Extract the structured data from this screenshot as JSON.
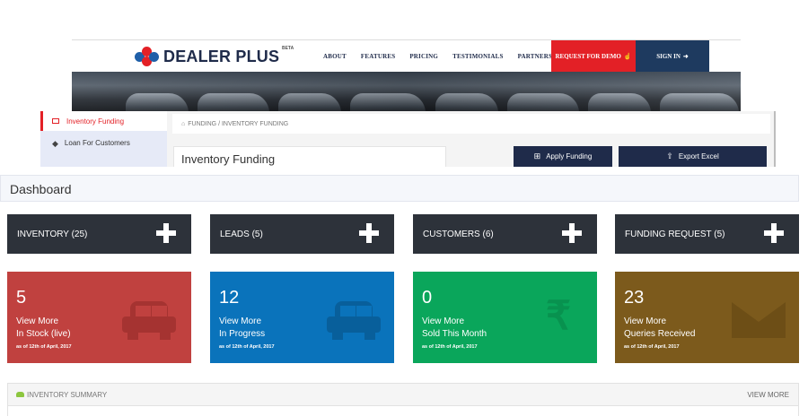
{
  "site": {
    "logo_text": "DEALER PLUS",
    "logo_beta": "BETA",
    "nav": [
      "ABOUT",
      "FEATURES",
      "PRICING",
      "TESTIMONIALS",
      "PARTNERS"
    ],
    "demo_label": "REQUEST FOR DEMO",
    "signin_label": "SIGN IN"
  },
  "sidebar": {
    "active_item": "Inventory Funding",
    "item": "Loan For Customers"
  },
  "inner": {
    "breadcrumb": "FUNDING / INVENTORY FUNDING",
    "title": "Inventory Funding",
    "apply_button": "Apply Funding",
    "export_button": "Export Excel"
  },
  "dashboard": {
    "title": "Dashboard",
    "tiles": [
      {
        "label": "INVENTORY (25)"
      },
      {
        "label": "LEADS (5)"
      },
      {
        "label": "CUSTOMERS (6)"
      },
      {
        "label": "FUNDING REQUEST (5)"
      }
    ],
    "stats": [
      {
        "value": "5",
        "view_more": "View More",
        "subtitle": "In Stock (live)",
        "asof": "as of 12th of April, 2017",
        "color": "#c0413f",
        "icon": "car-icon"
      },
      {
        "value": "12",
        "view_more": "View More",
        "subtitle": "In Progress",
        "asof": "as of 12th of April, 2017",
        "color": "#0a73bb",
        "icon": "car-icon"
      },
      {
        "value": "0",
        "view_more": "View More",
        "subtitle": "Sold This Month",
        "asof": "as of 12th of April, 2017",
        "color": "#0aa65b",
        "icon": "rupee-icon"
      },
      {
        "value": "23",
        "view_more": "View More",
        "subtitle": "Queries Received",
        "asof": "as of 12th of April, 2017",
        "color": "#7c5a1c",
        "icon": "envelope-icon"
      }
    ]
  },
  "summary": {
    "title": "INVENTORY SUMMARY",
    "view_more": "VIEW MORE"
  },
  "colors": {
    "brand_red": "#e32026",
    "brand_navy": "#1f2b4a",
    "tile_dark": "#2d323a"
  }
}
